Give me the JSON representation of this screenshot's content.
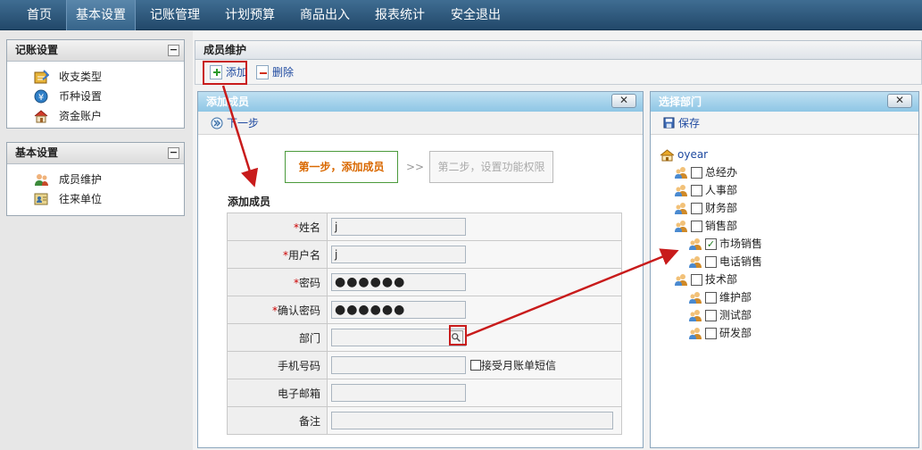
{
  "nav": {
    "items": [
      "首页",
      "基本设置",
      "记账管理",
      "计划预算",
      "商品出入",
      "报表统计",
      "安全退出"
    ],
    "active": "基本设置"
  },
  "sidebar": {
    "panel1": {
      "title": "记账设置",
      "collapse": "−",
      "items": [
        {
          "label": "收支类型",
          "icon": "notebook-icon"
        },
        {
          "label": "币种设置",
          "icon": "currency-icon"
        },
        {
          "label": "资金账户",
          "icon": "house-icon"
        }
      ]
    },
    "panel2": {
      "title": "基本设置",
      "collapse": "−",
      "items": [
        {
          "label": "成员维护",
          "icon": "members-icon"
        },
        {
          "label": "往来单位",
          "icon": "contacts-icon"
        }
      ]
    }
  },
  "main": {
    "title": "成员维护",
    "toolbar": {
      "add": "添加",
      "delete": "删除"
    }
  },
  "add_dialog": {
    "title": "添加成员",
    "close": "✕",
    "next": "下一步",
    "step1": "第一步，添加成员",
    "step_sep": ">>",
    "step2": "第二步，设置功能权限",
    "form_title": "添加成员",
    "fields": {
      "name_label": "姓名",
      "name_value": "j",
      "username_label": "用户名",
      "username_value": "j",
      "password_label": "密码",
      "password_value": "●●●●●●",
      "confirm_label": "确认密码",
      "confirm_value": "●●●●●●",
      "dept_label": "部门",
      "mobile_label": "手机号码",
      "sms_label": "接受月账单短信",
      "email_label": "电子邮箱",
      "note_label": "备注"
    },
    "required_mark": "*"
  },
  "dept_dialog": {
    "title": "选择部门",
    "close": "✕",
    "save": "保存",
    "root": "oyear",
    "tree": [
      {
        "label": "总经办",
        "checked": false,
        "level": 1
      },
      {
        "label": "人事部",
        "checked": false,
        "level": 1
      },
      {
        "label": "财务部",
        "checked": false,
        "level": 1
      },
      {
        "label": "销售部",
        "checked": false,
        "level": 1
      },
      {
        "label": "市场销售",
        "checked": true,
        "level": 2
      },
      {
        "label": "电话销售",
        "checked": false,
        "level": 2
      },
      {
        "label": "技术部",
        "checked": false,
        "level": 1
      },
      {
        "label": "维护部",
        "checked": false,
        "level": 2
      },
      {
        "label": "测试部",
        "checked": false,
        "level": 2
      },
      {
        "label": "研发部",
        "checked": false,
        "level": 2
      }
    ]
  },
  "colors": {
    "nav": "#2e5a80",
    "accent": "#c81b1b",
    "link": "#1f4aa0",
    "step_text": "#d96800"
  }
}
